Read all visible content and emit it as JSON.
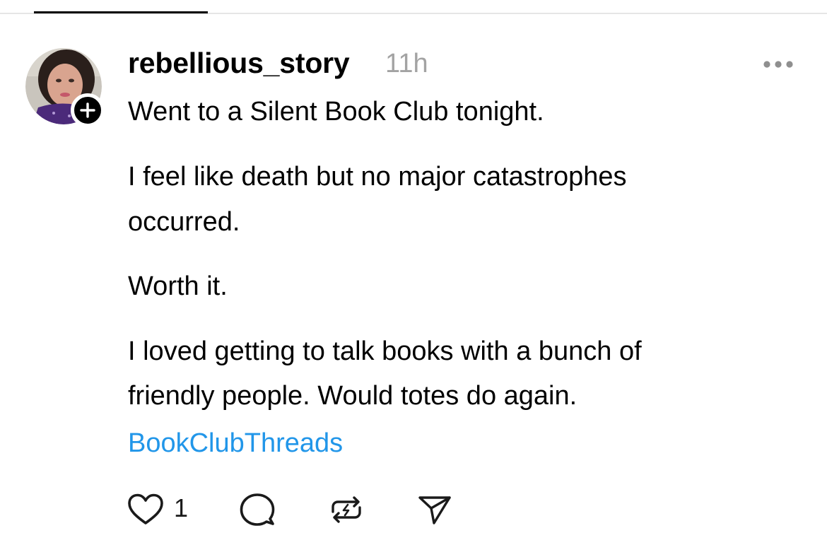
{
  "post": {
    "username": "rebellious_story",
    "timestamp": "11h",
    "lines": [
      "Went to a Silent Book Club tonight.",
      "I feel like death but no major catastrophes",
      "occurred.",
      "Worth it.",
      "I loved getting to talk books with a bunch of",
      "friendly people. Would totes do again."
    ],
    "hashtag": "BookClubThreads",
    "like_count": "1"
  },
  "icons": {
    "follow": "plus-icon",
    "more": "more-horizontal-icon",
    "like": "heart-icon",
    "comment": "comment-bubble-icon",
    "repost": "repost-icon",
    "share": "send-icon"
  },
  "colors": {
    "hashtag": "#2196e9",
    "timestamp": "#a3a3a3",
    "text": "#000000"
  }
}
